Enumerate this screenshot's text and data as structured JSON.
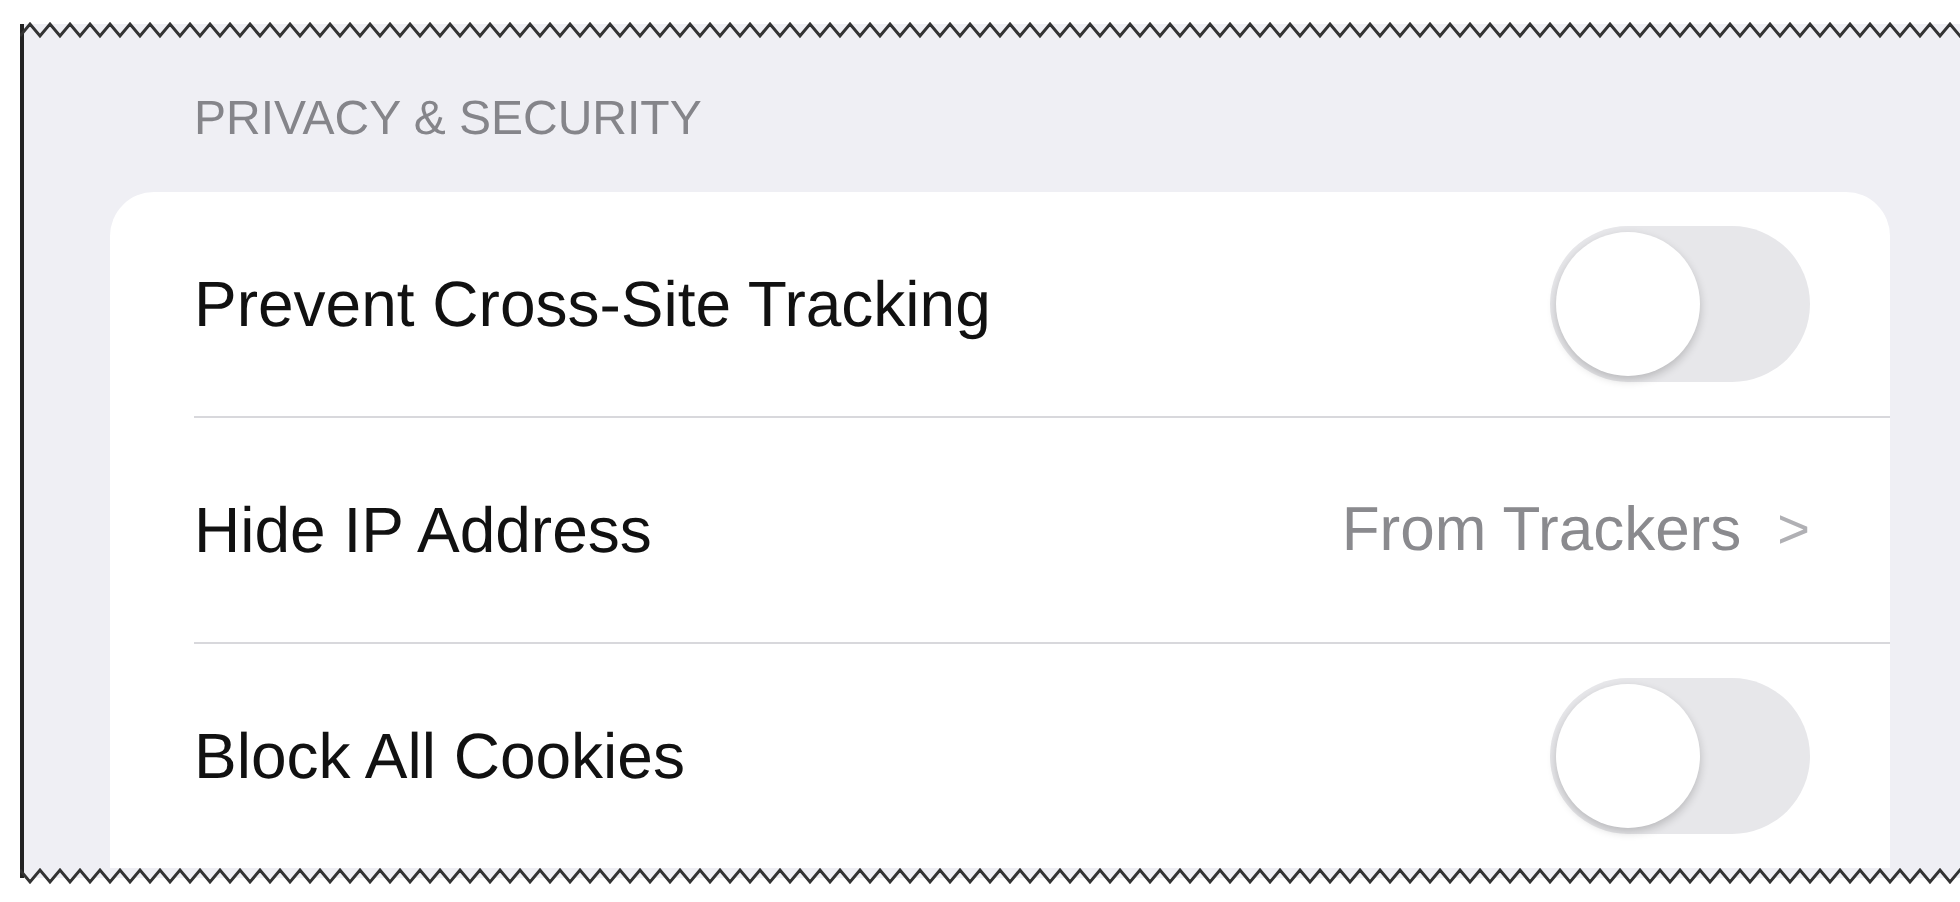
{
  "section": {
    "header": "PRIVACY & SECURITY"
  },
  "rows": [
    {
      "kind": "toggle",
      "label": "Prevent Cross-Site Tracking",
      "on": false
    },
    {
      "kind": "link",
      "label": "Hide IP Address",
      "value": "From Trackers",
      "chevron": ">"
    },
    {
      "kind": "toggle",
      "label": "Block All Cookies",
      "on": false
    }
  ]
}
